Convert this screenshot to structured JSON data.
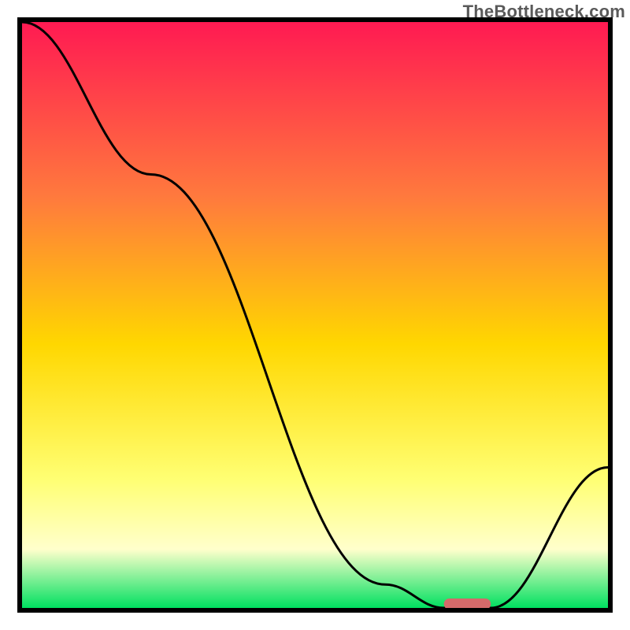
{
  "watermark": "TheBottleneck.com",
  "chart_data": {
    "type": "line",
    "title": "",
    "xlabel": "",
    "ylabel": "",
    "xlim": [
      0,
      100
    ],
    "ylim": [
      0,
      100
    ],
    "grid": false,
    "legend": false,
    "annotations": [],
    "series": [
      {
        "name": "curve",
        "x": [
          0,
          22,
          62,
          72,
          80,
          100
        ],
        "values": [
          100,
          74,
          4,
          0,
          0,
          24
        ]
      }
    ],
    "marker_segment": {
      "x_start": 72,
      "x_end": 80,
      "y": 0,
      "color": "#d46a6a"
    },
    "background_gradient": {
      "top_color": "#ff1a52",
      "upper_mid_color": "#ff7a3d",
      "mid_color": "#ffd700",
      "lower_mid_color": "#ffff73",
      "pale_band_color": "#ffffcc",
      "bottom_color": "#00e060"
    },
    "frame_color": "#000000",
    "line_color": "#000000"
  }
}
